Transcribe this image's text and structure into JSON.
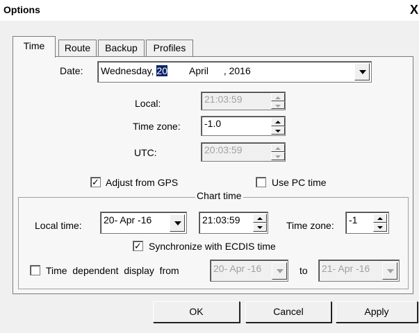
{
  "window": {
    "title": "Options",
    "close_glyph": "X"
  },
  "tabs": [
    {
      "label": "Time",
      "active": true
    },
    {
      "label": "Route",
      "active": false
    },
    {
      "label": "Backup",
      "active": false
    },
    {
      "label": "Profiles",
      "active": false
    }
  ],
  "date": {
    "label": "Date:",
    "weekday": "Wednesday,",
    "day": "20",
    "month": "April",
    "year": ", 2016"
  },
  "local": {
    "label": "Local:",
    "value": "21:03:59"
  },
  "time_zone": {
    "label": "Time zone:",
    "value": "-1.0"
  },
  "utc": {
    "label": "UTC:",
    "value": "20:03:59"
  },
  "adjust_gps": {
    "label": "Adjust from GPS",
    "checked": true,
    "mark": "✓"
  },
  "use_pc_time": {
    "label": "Use PC time",
    "checked": false
  },
  "chart_time": {
    "title": "Chart time",
    "local_time_label": "Local time:",
    "date_value": "20- Apr -16",
    "time_value": "21:03:59",
    "zone_label": "Time zone:",
    "zone_value": "-1",
    "sync_label": "Synchronize with ECDIS time",
    "sync_checked": true,
    "sync_mark": "✓",
    "dependent_label": "Time  dependent  display  from",
    "dependent_checked": false,
    "from_value": "20- Apr -16",
    "to_label": "to",
    "to_value": "21- Apr -16"
  },
  "buttons": {
    "ok": "OK",
    "cancel": "Cancel",
    "apply": "Apply"
  },
  "colors": {
    "selection": "#0a246a",
    "disabled_text": "#a0a0a0",
    "panel": "#f7f7f7"
  }
}
